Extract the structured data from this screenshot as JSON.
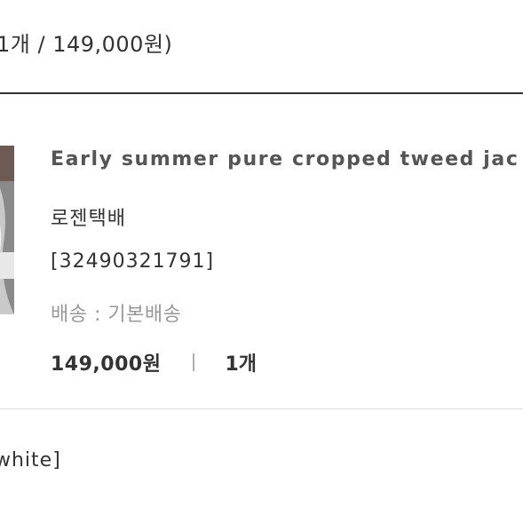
{
  "order": {
    "summary": "1개 / 149,000원)"
  },
  "item": {
    "thumbnail_icon": "product-thumbnail",
    "name": "Early summer pure cropped tweed jac",
    "courier": "로젠택배",
    "tracking_number": "[32490321791]",
    "shipping": "배송 : 기본배송",
    "price": "149,000원",
    "quantity": "1개"
  },
  "option": {
    "text": "white]"
  }
}
